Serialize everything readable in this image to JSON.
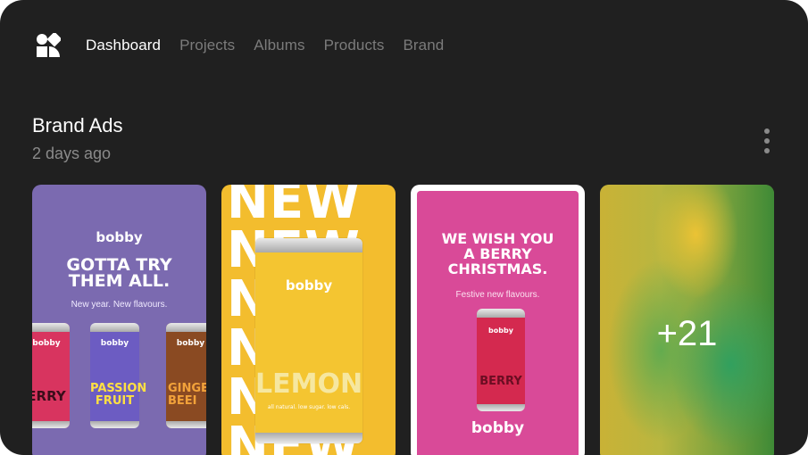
{
  "nav": {
    "logo_icon": "app-logo-icon",
    "items": [
      {
        "label": "Dashboard",
        "active": true
      },
      {
        "label": "Projects",
        "active": false
      },
      {
        "label": "Albums",
        "active": false
      },
      {
        "label": "Products",
        "active": false
      },
      {
        "label": "Brand",
        "active": false
      }
    ]
  },
  "section": {
    "title": "Brand Ads",
    "subtitle": "2 days ago",
    "menu_icon": "more-vertical-icon"
  },
  "cards": {
    "c1": {
      "brand": "bobby",
      "headline_1": "GOTTA TRY",
      "headline_2": "THEM ALL.",
      "tagline": "New year. New flavours.",
      "can_left_brand": "bobby",
      "can_left_flavor": "ERRY",
      "can_mid_brand": "bobby",
      "can_mid_flavor_1": "PASSION",
      "can_mid_flavor_2": "FRUIT",
      "can_right_brand": "bobby",
      "can_right_flavor_1": "GINGE",
      "can_right_flavor_2": "BEEI"
    },
    "c2": {
      "background_text": "NEW\nNEW\nNEW\nNEW\nNEW\nNEW",
      "can_brand": "bobby",
      "can_flavor": "LEMON",
      "can_desc": "all natural. low sugar. low cals."
    },
    "c3": {
      "headline_1": "WE WISH YOU",
      "headline_2": "A BERRY",
      "headline_3": "CHRISTMAS.",
      "tagline": "Festive new flavours.",
      "can_brand": "bobby",
      "can_flavor": "BERRY",
      "brand": "bobby"
    },
    "c4": {
      "more_count": "+21"
    }
  },
  "colors": {
    "window_bg": "#202020",
    "nav_active": "#ffffff",
    "nav_inactive": "#7b7b7b",
    "purple": "#7b6ab0",
    "yellow": "#f3bd2e",
    "pink": "#d94a98"
  }
}
